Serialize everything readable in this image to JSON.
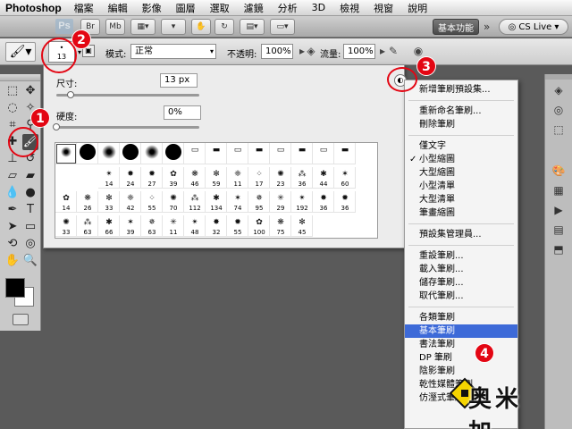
{
  "menubar": {
    "app": "Photoshop",
    "menus": [
      "檔案",
      "編輯",
      "影像",
      "圖層",
      "選取",
      "濾鏡",
      "分析",
      "3D",
      "檢視",
      "視窗",
      "說明"
    ]
  },
  "appbar": {
    "logo": "Ps",
    "mb_label": "Mb",
    "workspace": "基本功能",
    "more": "»",
    "cs_live": "CS Live"
  },
  "options": {
    "brush_size_value": "13",
    "mode_label": "模式:",
    "mode_value": "正常",
    "opacity_label": "不透明:",
    "opacity_value": "100%",
    "flow_label": "流量:",
    "flow_value": "100%"
  },
  "brush_panel": {
    "size_label": "尺寸:",
    "size_value": "13 px",
    "hardness_label": "硬度:",
    "hardness_value": "0%",
    "size_slider_level": 0.1,
    "hardness_slider_level": 0.0,
    "presets": [
      [
        "",
        "",
        "",
        "",
        "",
        "",
        "",
        "",
        "",
        "",
        "",
        "",
        "",
        "",
        "",
        ""
      ],
      [
        "",
        "",
        "14",
        "24",
        "27",
        "39",
        "46",
        "59",
        "11",
        "17",
        "23",
        "36",
        "44",
        "60",
        "",
        ""
      ],
      [
        "14",
        "26",
        "33",
        "42",
        "55",
        "70",
        "112",
        "134",
        "74",
        "95",
        "29",
        "192",
        "36",
        "36",
        "",
        ""
      ],
      [
        "33",
        "63",
        "66",
        "39",
        "63",
        "11",
        "48",
        "32",
        "55",
        "100",
        "75",
        "45",
        "",
        "",
        "",
        ""
      ]
    ]
  },
  "context_menu": {
    "items": [
      {
        "label": "新增筆刷預設集...",
        "checked": false,
        "highlight": false
      },
      {
        "sep": true
      },
      {
        "label": "重新命名筆刷...",
        "checked": false,
        "highlight": false
      },
      {
        "label": "刪除筆刷",
        "checked": false,
        "highlight": false
      },
      {
        "sep": true
      },
      {
        "label": "僅文字",
        "checked": false,
        "highlight": false
      },
      {
        "label": "小型縮圖",
        "checked": true,
        "highlight": false
      },
      {
        "label": "大型縮圖",
        "checked": false,
        "highlight": false
      },
      {
        "label": "小型清單",
        "checked": false,
        "highlight": false
      },
      {
        "label": "大型清單",
        "checked": false,
        "highlight": false
      },
      {
        "label": "筆畫縮圖",
        "checked": false,
        "highlight": false
      },
      {
        "sep": true
      },
      {
        "label": "預設集管理員...",
        "checked": false,
        "highlight": false
      },
      {
        "sep": true
      },
      {
        "label": "重設筆刷...",
        "checked": false,
        "highlight": false
      },
      {
        "label": "載入筆刷...",
        "checked": false,
        "highlight": false
      },
      {
        "label": "儲存筆刷...",
        "checked": false,
        "highlight": false
      },
      {
        "label": "取代筆刷...",
        "checked": false,
        "highlight": false
      },
      {
        "sep": true
      },
      {
        "label": "各類筆刷",
        "checked": false,
        "highlight": false
      },
      {
        "label": "基本筆刷",
        "checked": false,
        "highlight": true
      },
      {
        "label": "書法筆刷",
        "checked": false,
        "highlight": false
      },
      {
        "label": "DP 筆刷",
        "checked": false,
        "highlight": false
      },
      {
        "label": "陰影筆刷",
        "checked": false,
        "highlight": false
      },
      {
        "label": "乾性媒體筆刷",
        "checked": false,
        "highlight": false
      },
      {
        "label": "仿溼式筆刷",
        "checked": false,
        "highlight": false
      }
    ]
  },
  "callouts": [
    "1",
    "2",
    "3",
    "4"
  ],
  "watermark": {
    "text": "奥米加"
  },
  "colors": {
    "callout": "#e30613",
    "highlight": "#3d6ad8"
  },
  "icons": {
    "tools": [
      "move-icon",
      "marquee-icon",
      "lasso-icon",
      "wand-icon",
      "crop-icon",
      "eyedropper-icon",
      "healing-icon",
      "brush-icon",
      "stamp-icon",
      "history-brush-icon",
      "eraser-icon",
      "gradient-icon",
      "blur-icon",
      "dodge-icon",
      "pen-icon",
      "type-icon",
      "path-select-icon",
      "shape-icon",
      "hand-icon",
      "zoom-icon"
    ]
  }
}
